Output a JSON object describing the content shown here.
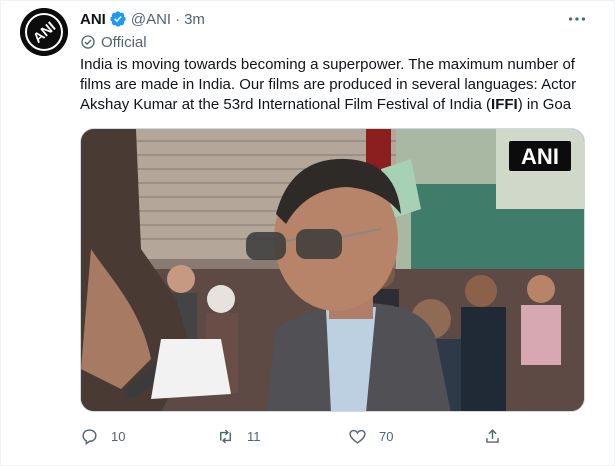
{
  "tweet": {
    "author_name": "ANI",
    "author_handle": "@ANI",
    "separator": "·",
    "time": "3m",
    "official_label": "Official",
    "text_lines": [
      "India is moving towards becoming a superpower. The maximum number of",
      "films are made in India. Our films are produced in several languages: Actor",
      "Akshay Kumar at the 53rd International Film Festival of India (",
      "IFFI",
      ") in Goa"
    ],
    "avatar_text": "ANI",
    "media_watermark": "ANI",
    "counts": {
      "replies": "10",
      "retweets": "11",
      "likes": "70"
    }
  },
  "icons": {
    "verified": "verified-badge-icon",
    "more": "more-horizontal-icon",
    "official": "official-badge-icon",
    "reply": "reply-icon",
    "retweet": "retweet-icon",
    "like": "heart-icon",
    "share": "share-icon"
  },
  "colors": {
    "text": "#0f1419",
    "secondary": "#536471",
    "verified_blue": "#1d9bf0",
    "border": "#cfd9de"
  }
}
